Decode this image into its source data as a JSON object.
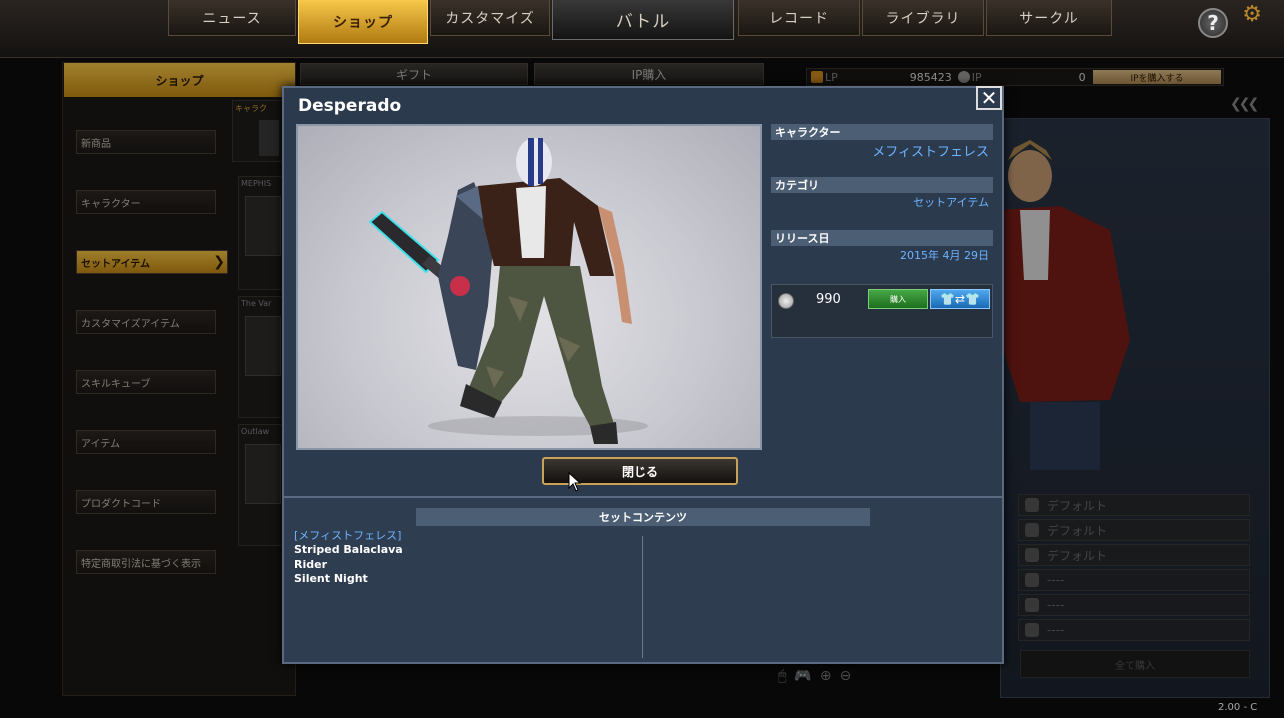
{
  "nav": {
    "tabs": [
      {
        "label": "ニュース"
      },
      {
        "label": "ショップ"
      },
      {
        "label": "カスタマイズ"
      },
      {
        "label": "バトル"
      },
      {
        "label": "レコード"
      },
      {
        "label": "ライブラリ"
      },
      {
        "label": "サークル"
      }
    ],
    "help_label": "?"
  },
  "shop": {
    "tabs": [
      "ショップ",
      "ギフト",
      "IP購入"
    ],
    "categories": [
      "新商品",
      "キャラクター",
      "セットアイテム",
      "カスタマイズアイテム",
      "スキルキューブ",
      "アイテム",
      "プロダクトコード",
      "特定商取引法に基づく表示"
    ],
    "active_category": "セットアイテム",
    "character_tab": "キャラク",
    "product_labels": [
      "MEPHIS",
      "The Var",
      "Outlaw"
    ]
  },
  "currency": {
    "lp_label": "LP",
    "lp_value": "985423",
    "ip_label": "IP",
    "ip_value": "0",
    "ip_buy_label": "IPを購入する"
  },
  "equip_slots": [
    "デフォルト",
    "デフォルト",
    "デフォルト",
    "----",
    "----",
    "----"
  ],
  "buy_all_label": "全て購入",
  "version": "2.00   - C",
  "modal": {
    "title": "Desperado",
    "close_x": "✕",
    "character_header": "キャラクター",
    "character_value": "メフィストフェレス",
    "category_header": "カテゴリ",
    "category_value": "セットアイテム",
    "release_header": "リリース日",
    "release_value": "2015年 4月 29日",
    "price": "990",
    "buy_label": "購入",
    "try_label": "👕⇄👕",
    "close_label": "閉じる",
    "contents_header": "セットコンテンツ",
    "contents_group": "[メフィストフェレス]",
    "contents_items": [
      "Striped Balaclava",
      "Rider",
      "Silent Night"
    ]
  },
  "colors": {
    "accent_gold": "#f3c242",
    "modal_bg": "#2c3a4e",
    "value_blue": "#6cb4ff",
    "buy_green": "#2d8a2d",
    "try_blue": "#1a68b4"
  }
}
